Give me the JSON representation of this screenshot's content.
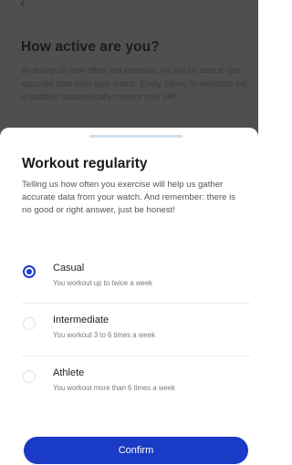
{
  "background_page": {
    "back_icon": "chevron-left-icon",
    "title": "How active are you?",
    "description": "By telling us how often you exercise, we will be able to get accurate data from your watch. Every 10mn, ScanWatch will in addition automatically monitor your HR."
  },
  "sheet": {
    "title": "Workout regularity",
    "description": "Telling us how often you exercise will help us gather accurate data from your watch. And remember: there is no good or right answer, just be honest!",
    "options": [
      {
        "label": "Casual",
        "sublabel": "You workout up to twice a week",
        "selected": true
      },
      {
        "label": "Intermediate",
        "sublabel": "You workout 3 to 6 times a week",
        "selected": false
      },
      {
        "label": "Athlete",
        "sublabel": "You workout more than 6 times a week",
        "selected": false
      }
    ],
    "confirm_label": "Confirm"
  },
  "colors": {
    "accent": "#1a3bc6",
    "overlay": "#4f4f4f"
  }
}
